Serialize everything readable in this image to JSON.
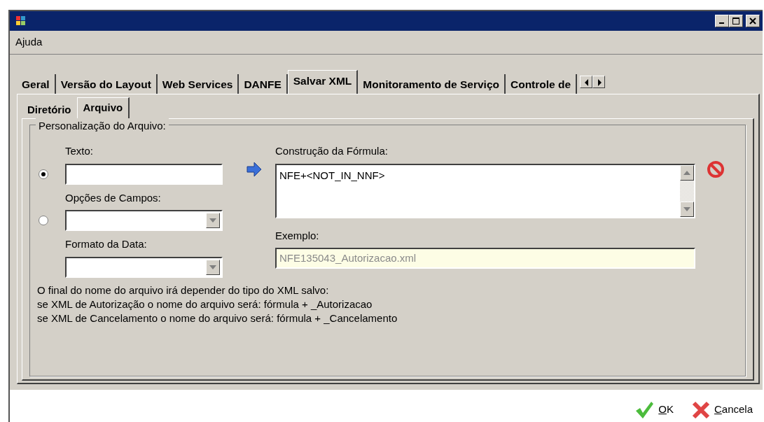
{
  "menu": [
    {
      "label": "Ajuda"
    }
  ],
  "tabs": [
    {
      "label": "Geral",
      "selected": false
    },
    {
      "label": "Versão do Layout",
      "selected": false
    },
    {
      "label": "Web Services",
      "selected": false
    },
    {
      "label": "DANFE",
      "selected": false
    },
    {
      "label": "Salvar XML",
      "selected": true
    },
    {
      "label": "Monitoramento de Serviço",
      "selected": false
    },
    {
      "label": "Controle de",
      "selected": false
    }
  ],
  "subtabs": [
    {
      "label": "Diretório",
      "selected": false
    },
    {
      "label": "Arquivo",
      "selected": true
    }
  ],
  "group": {
    "title": "Personalização do Arquivo:",
    "sources": [
      {
        "kind": "text",
        "label": "Texto:",
        "selected": true
      },
      {
        "kind": "combo",
        "label": "Opções de Campos:",
        "selected": false
      }
    ],
    "date_format": {
      "label": "Formato da Data:"
    },
    "formula": {
      "label": "Construção da Fórmula:",
      "value": "NFE+<NOT_IN_NNF>"
    },
    "example": {
      "label": "Exemplo:",
      "value": "NFE135043_Autorizacao.xml",
      "disabled": true
    },
    "notes": [
      "O final do nome do arquivo irá depender do tipo do XML salvo:",
      "se XML de Autorização o nome do arquivo será: fórmula + _Autorizacao",
      "se XML de Cancelamento o nome do arquivo será: fórmula + _Cancelamento"
    ]
  },
  "buttons": [
    {
      "kind": "ok",
      "accel": "O",
      "label_rest": "K"
    },
    {
      "kind": "cancel",
      "accel": "C",
      "label_rest": "ancela"
    }
  ]
}
